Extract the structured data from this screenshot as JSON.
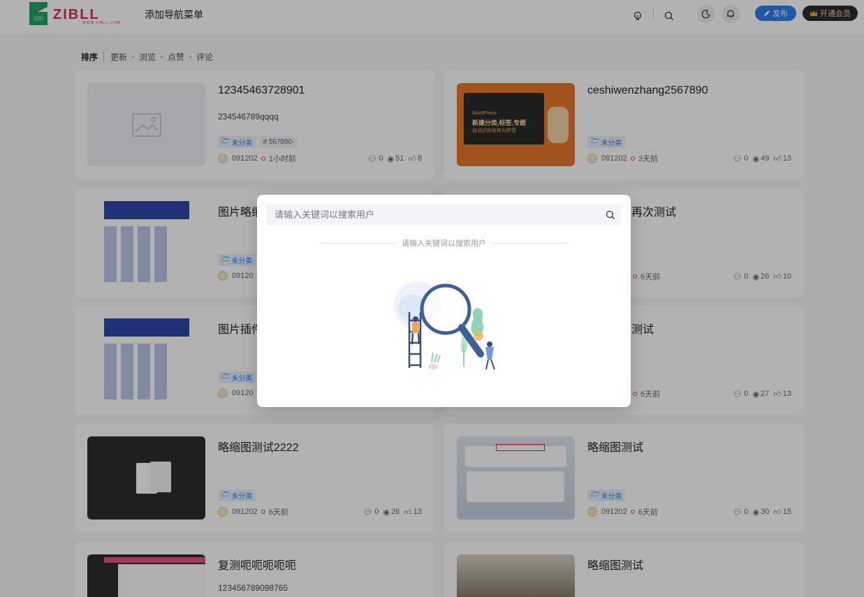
{
  "header": {
    "logo_text": "ZIBLL",
    "logo_subtext": "WWW.ZIBLL.COM",
    "nav_title": "添加导航菜单",
    "publish_label": "发布",
    "vip_label": "开通会员"
  },
  "sortbar": {
    "label": "排序",
    "options": [
      "更新",
      "浏览",
      "点赞",
      "评论"
    ]
  },
  "cards": [
    {
      "title": "12345463728901",
      "excerpt": "234546789qqqq",
      "category": "未分类",
      "tag": "# 567890-",
      "author": "091202",
      "time": "1小时前",
      "comments": "0",
      "views": "51",
      "likes": "8",
      "thumb": "placeholder"
    },
    {
      "title": "ceshiwenzhang2567890",
      "excerpt": "",
      "category": "未分类",
      "tag": "",
      "author": "091202",
      "time": "3天前",
      "comments": "0",
      "views": "49",
      "likes": "13",
      "thumb": "orange-banner",
      "thumb_text": [
        "WordPress",
        "新建分类,标签,专题",
        "自动识别名称为拼音"
      ]
    },
    {
      "title": "图片略缩",
      "excerpt": "",
      "category": "未分类",
      "tag": "",
      "author": "09120",
      "time": "",
      "comments": "",
      "views": "",
      "likes": "",
      "thumb": "screenshot"
    },
    {
      "title": "再次测试",
      "excerpt": "",
      "category": "",
      "tag": "",
      "author": "",
      "time": "6天前",
      "comments": "0",
      "views": "26",
      "likes": "10",
      "thumb": "none"
    },
    {
      "title": "图片插件",
      "excerpt": "",
      "category": "未分类",
      "tag": "",
      "author": "09120",
      "time": "",
      "comments": "",
      "views": "",
      "likes": "",
      "thumb": "screenshot"
    },
    {
      "title": "测试",
      "excerpt": "",
      "category": "",
      "tag": "",
      "author": "",
      "time": "6天前",
      "comments": "0",
      "views": "27",
      "likes": "13",
      "thumb": "none"
    },
    {
      "title": "略缩图测试2222",
      "excerpt": "",
      "category": "未分类",
      "tag": "",
      "author": "091202",
      "time": "6天前",
      "comments": "0",
      "views": "26",
      "likes": "13",
      "thumb": "dark-screenshot"
    },
    {
      "title": "略缩图测试",
      "excerpt": "",
      "category": "未分类",
      "tag": "",
      "author": "091202",
      "time": "6天前",
      "comments": "0",
      "views": "30",
      "likes": "15",
      "thumb": "light-screenshot"
    },
    {
      "title": "复测呃呃呃呃呃",
      "excerpt": "123456789098765",
      "category": "",
      "tag": "",
      "author": "",
      "time": "",
      "comments": "",
      "views": "",
      "likes": "",
      "thumb": "app-screenshot"
    },
    {
      "title": "略缩图测试",
      "excerpt": "",
      "category": "",
      "tag": "",
      "author": "",
      "time": "",
      "comments": "",
      "views": "",
      "likes": "",
      "thumb": "photo"
    }
  ],
  "modal": {
    "search_placeholder": "请输入关键词以搜索用户",
    "hint": "请输入关键词以搜索用户"
  },
  "colors": {
    "accent": "#2d7ff0",
    "brand_red": "#c9324a",
    "brand_green": "#1fa463",
    "vip_bg": "#2c2c2c",
    "overlay": "rgba(0,0,0,0.3)"
  },
  "icons": [
    "lightbulb-icon",
    "search-icon",
    "moon-icon",
    "bell-icon",
    "pen-icon",
    "crown-icon",
    "folder-icon",
    "comment-icon",
    "eye-icon",
    "thumb-up-icon",
    "image-placeholder-icon"
  ]
}
